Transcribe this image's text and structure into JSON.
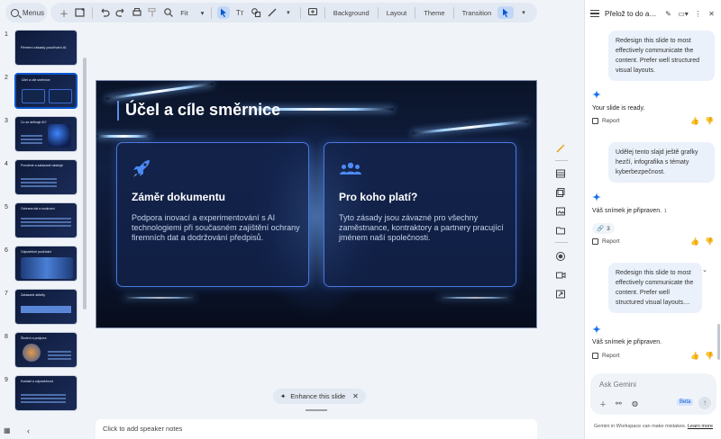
{
  "toolbar": {
    "menus_label": "Menus",
    "zoom_label": "Fit",
    "background_label": "Background",
    "layout_label": "Layout",
    "theme_label": "Theme",
    "transition_label": "Transition"
  },
  "filmstrip": {
    "slides": [
      {
        "num": "1",
        "title": "Firemní zásady používání AI"
      },
      {
        "num": "2",
        "title": "Účel a cíle směrnice"
      },
      {
        "num": "3",
        "title": "Co se definuje AI?"
      },
      {
        "num": "4",
        "title": "Povolené a zakázané nástroje"
      },
      {
        "num": "5",
        "title": "Ochrana dat a soukromí"
      },
      {
        "num": "6",
        "title": "Odpovědné používání"
      },
      {
        "num": "7",
        "title": "Zakázané aktivity"
      },
      {
        "num": "8",
        "title": "Školení a podpora"
      },
      {
        "num": "9",
        "title": "Kontakt a odpovědnost"
      }
    ]
  },
  "slide": {
    "title": "Účel a cíle směrnice",
    "cards": [
      {
        "title": "Záměr dokumentu",
        "body": "Podpora inovací a experimentování s AI technologiemi při současném zajištění ochrany firemních dat a dodržování předpisů."
      },
      {
        "title": "Pro koho platí?",
        "body": "Tyto zásady jsou závazné pro všechny zaměstnance, kontraktory a partnery pracující jménem naší společnosti."
      }
    ]
  },
  "enhance": {
    "label": "Enhance this slide"
  },
  "notes": {
    "placeholder": "Click to add speaker notes"
  },
  "gemini": {
    "title": "Přelož to do angli...",
    "messages": {
      "user1": "Redesign this slide to most effectively communicate the content. Prefer well structured visual layouts.",
      "reply1": "Your slide is ready.",
      "user2": "Udělej tento slajd ještě grafky hezčí, infografika s tématy kyberbezpečnost.",
      "reply2": "Váš snímek je připraven.",
      "reply2_sup": "1",
      "source_count": "3",
      "user3": "Redesign this slide to most effectively communicate the content. Prefer well structured visual layouts....",
      "reply3": "Váš snímek je připraven."
    },
    "report_label": "Report",
    "ask_placeholder": "Ask Gemini",
    "beta_label": "Beta",
    "disclaimer": "Gemini in Workspace can make mistakes.",
    "learn_more": "Learn more"
  },
  "colors": {
    "accent": "#0b57d0",
    "slide_bg": "#0d1833",
    "card_border": "#4a78e0",
    "icon_blue": "#4d8bf5"
  }
}
